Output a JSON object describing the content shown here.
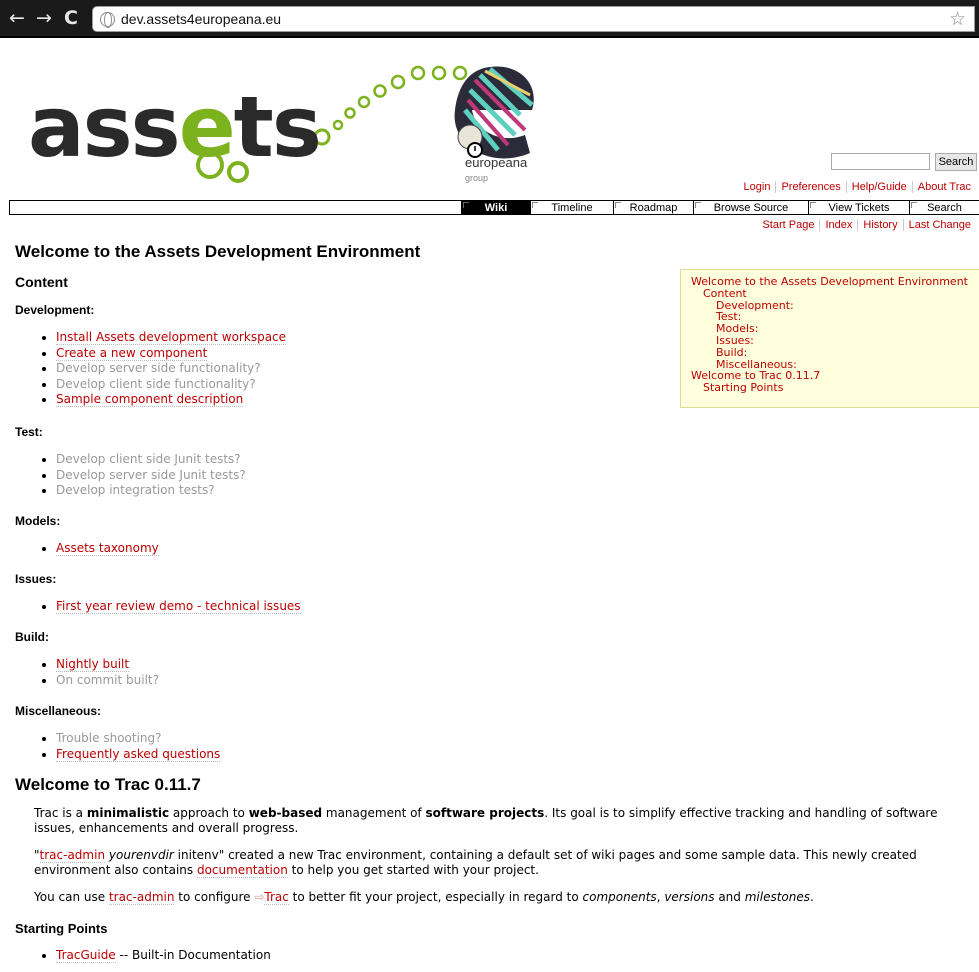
{
  "browser": {
    "url": "dev.assets4europeana.eu",
    "back_icon": "back-arrow-icon",
    "forward_icon": "forward-arrow-icon",
    "reload_icon": "reload-icon",
    "bookmark_icon": "star-icon"
  },
  "header": {
    "logo_prefix": "ass",
    "logo_letter": "e",
    "logo_suffix": "ts",
    "europeana_label": "europeana",
    "group_label": "group",
    "search_button": "Search",
    "search_value": ""
  },
  "metanav": {
    "items": [
      "Login",
      "Preferences",
      "Help/Guide",
      "About Trac"
    ]
  },
  "mainnav": {
    "tabs": [
      "Wiki",
      "Timeline",
      "Roadmap",
      "Browse Source",
      "View Tickets",
      "Search"
    ],
    "active": "Wiki"
  },
  "ctxnav": {
    "items": [
      "Start Page",
      "Index",
      "History",
      "Last Change"
    ]
  },
  "content": {
    "title": "Welcome to the Assets Development Environment",
    "content_heading": "Content",
    "development_heading": "Development:",
    "development_items": [
      {
        "text": "Install Assets development workspace",
        "missing": false
      },
      {
        "text": "Create a new component",
        "missing": false
      },
      {
        "text": "Develop server side functionality?",
        "missing": true
      },
      {
        "text": "Develop client side functionality?",
        "missing": true
      },
      {
        "text": "Sample component description",
        "missing": false
      }
    ],
    "test_heading": "Test:",
    "test_items": [
      {
        "text": "Develop client side Junit tests?",
        "missing": true
      },
      {
        "text": "Develop server side Junit tests?",
        "missing": true
      },
      {
        "text": "Develop integration tests?",
        "missing": true
      }
    ],
    "models_heading": "Models:",
    "models_items": [
      {
        "text": "Assets taxonomy",
        "missing": false
      }
    ],
    "issues_heading": "Issues:",
    "issues_items": [
      {
        "text": "First year review demo - technical issues",
        "missing": false
      }
    ],
    "build_heading": "Build:",
    "build_items": [
      {
        "text": "Nightly built",
        "missing": false
      },
      {
        "text": "On commit built?",
        "missing": true
      }
    ],
    "misc_heading": "Miscellaneous:",
    "misc_items": [
      {
        "text": "Trouble shooting?",
        "missing": true
      },
      {
        "text": "Frequently asked questions",
        "missing": false
      }
    ],
    "trac_title": "Welcome to Trac 0.11.7",
    "p1": {
      "a": "Trac is a ",
      "b": "minimalistic",
      "c": " approach to ",
      "d": "web-based",
      "e": " management of ",
      "f": "software projects",
      "g": ". Its goal is to simplify effective tracking and handling of software issues, enhancements and overall progress."
    },
    "p2": {
      "q1": "\"",
      "link1": "trac-admin",
      "sp": " ",
      "em": "yourenvdir",
      "mid": " initenv\" created a new Trac environment, containing a default set of wiki pages and some sample data. This newly created environment also contains ",
      "link2": "documentation",
      "end": " to help you get started with your project."
    },
    "p3": {
      "a": "You can use ",
      "link1": "trac-admin",
      "b": " to configure ",
      "ext_arrow": "⇨",
      "link2": "Trac",
      "c": " to better fit your project, especially in regard to ",
      "em1": "components",
      "d": ", ",
      "em2": "versions",
      "e": " and ",
      "em3": "milestones",
      "f": "."
    },
    "starting_heading": "Starting Points",
    "starting_items": [
      {
        "link": "TracGuide",
        "rest": " -- Built-in Documentation"
      }
    ]
  },
  "toc": {
    "items": [
      {
        "text": "Welcome to the Assets Development Environment",
        "level": 1
      },
      {
        "text": "Content",
        "level": 2
      },
      {
        "text": "Development:",
        "level": 3
      },
      {
        "text": "Test:",
        "level": 3
      },
      {
        "text": "Models:",
        "level": 3
      },
      {
        "text": "Issues:",
        "level": 3
      },
      {
        "text": "Build:",
        "level": 3
      },
      {
        "text": "Miscellaneous:",
        "level": 3
      },
      {
        "text": "Welcome to Trac 0.11.7",
        "level": 1
      },
      {
        "text": "Starting Points",
        "level": 2
      }
    ]
  },
  "colors": {
    "link": "#bb0000",
    "missing_link": "#999999",
    "logo_green": "#7cb21e",
    "toc_bg": "#ffffdd"
  }
}
